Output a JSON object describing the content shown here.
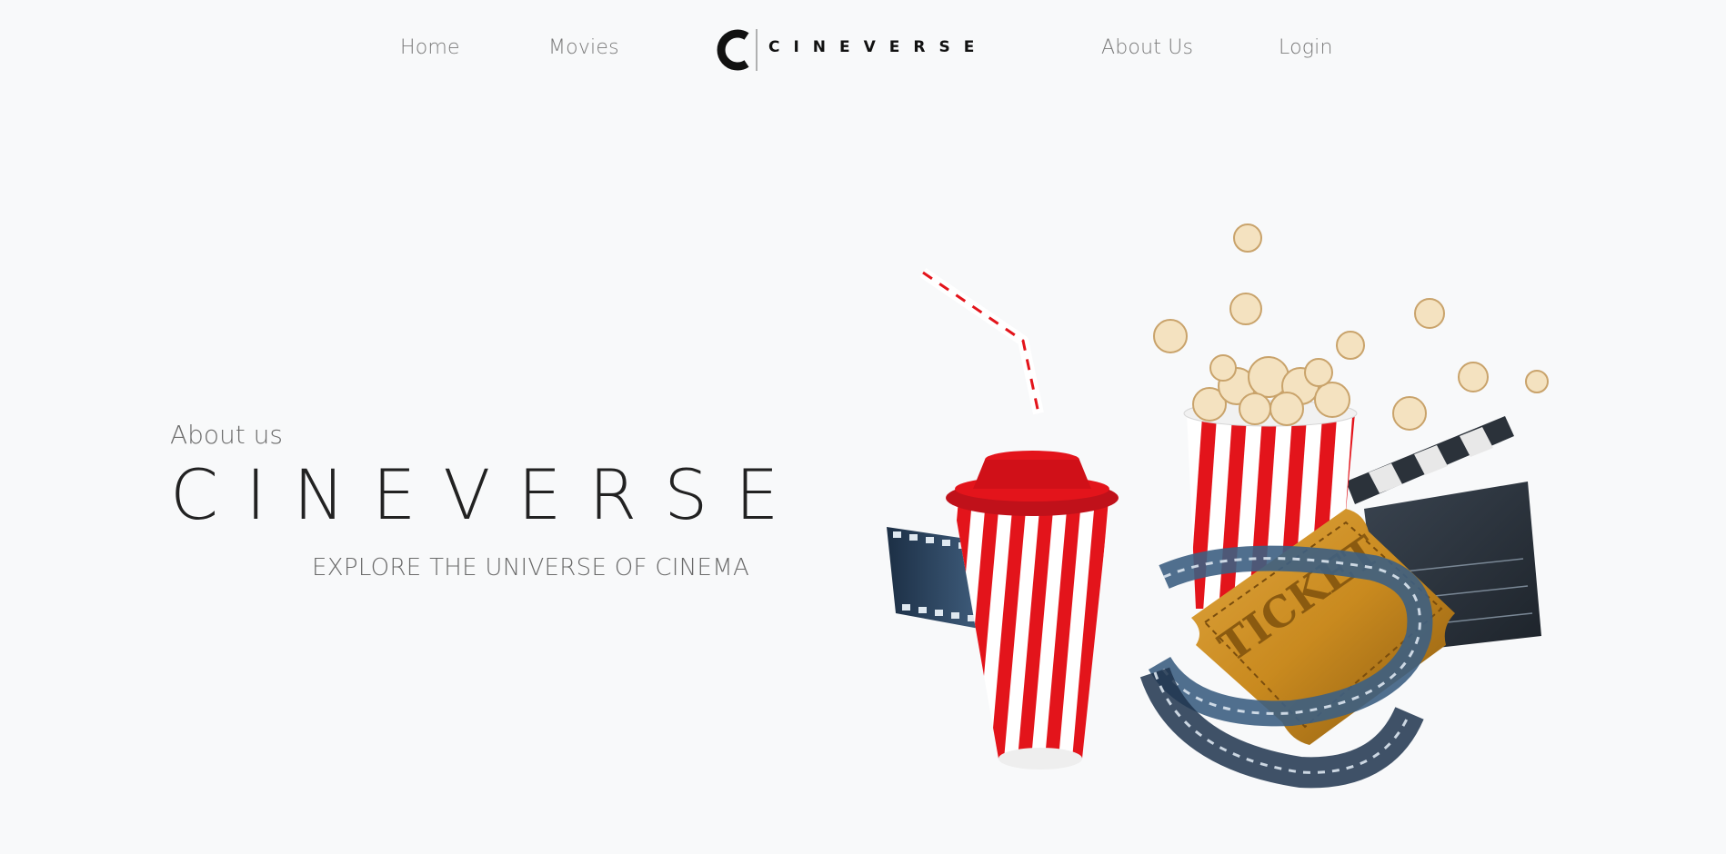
{
  "nav": {
    "home": "Home",
    "movies": "Movies",
    "about": "About Us",
    "login": "Login"
  },
  "logo": {
    "mark": "C",
    "text": "CINEVERSE"
  },
  "hero": {
    "eyebrow": "About us",
    "title": "CINEVERSE",
    "tagline": "EXPLORE THE UNIVERSE OF CINEMA"
  },
  "illustration": {
    "ticket_text": "TICKET",
    "icons": [
      "drink-cup-icon",
      "popcorn-bucket-icon",
      "ticket-icon",
      "film-reel-icon",
      "clapperboard-icon"
    ]
  },
  "colors": {
    "background": "#f8f9fa",
    "accent_red": "#e3141b",
    "gold": "#c98a1f",
    "text_dark": "#222222",
    "text_muted": "#7a7a7a"
  }
}
